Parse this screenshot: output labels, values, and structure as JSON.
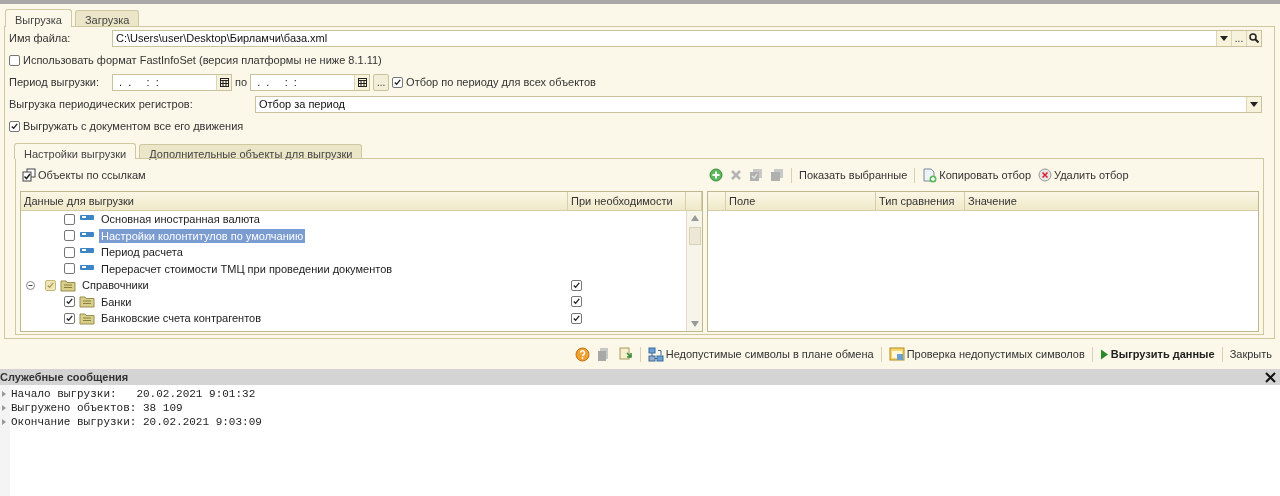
{
  "tabs": [
    {
      "label": "Выгрузка",
      "selected": true
    },
    {
      "label": "Загрузка",
      "selected": false
    }
  ],
  "form": {
    "file": {
      "label": "Имя файла:",
      "value": "C:\\Users\\user\\Desktop\\Бирламчи\\база.xml",
      "button": "..."
    },
    "fastinfoset": {
      "label": "Использовать формат FastInfoSet (версия платформы не ниже 8.1.11)",
      "checked": false
    },
    "period": {
      "label": "Период выгрузки:",
      "from": " .  .     :  :",
      "separator": "по",
      "to": " .  .     :  :",
      "button": "...",
      "filter": {
        "label": "Отбор по периоду для всех объектов",
        "checked": true
      }
    },
    "registers": {
      "label": "Выгрузка периодических регистров:",
      "value": "Отбор за период"
    },
    "movements": {
      "label": "Выгружать с документом все его движения",
      "checked": true
    }
  },
  "sub_tabs": [
    {
      "label": "Настройки выгрузки",
      "selected": true
    },
    {
      "label": "Дополнительные объекты для выгрузки",
      "selected": false
    }
  ],
  "objects_toggle": {
    "label": "Объекты по ссылкам"
  },
  "tree": {
    "columns": [
      "Данные для выгрузки",
      "При необходимости"
    ],
    "items": [
      {
        "children": [
          {
            "kind": "constant",
            "label": "Основная иностранная валюта",
            "checked": false,
            "selected": false
          },
          {
            "kind": "constant",
            "label": "Настройки колонтитулов по умолчанию",
            "checked": false,
            "selected": true
          },
          {
            "kind": "constant",
            "label": "Период расчета",
            "checked": false,
            "selected": false
          },
          {
            "kind": "constant",
            "label": "Перерасчет стоимости ТМЦ при проведении документов",
            "checked": false,
            "selected": false
          }
        ]
      },
      {
        "kind": "group",
        "label": "Справочники",
        "checked": true,
        "partial": true,
        "expanded": true,
        "on_demand": true,
        "selected": false,
        "children": [
          {
            "kind": "catalog",
            "label": "Банки",
            "checked": true,
            "on_demand": true,
            "selected": false
          },
          {
            "kind": "catalog",
            "label": "Банковские счета контрагентов",
            "checked": true,
            "on_demand": true,
            "selected": false
          }
        ]
      }
    ]
  },
  "filter_toolbar": {
    "show_selected": "Показать выбранные",
    "copy": "Копировать отбор",
    "remove": "Удалить отбор"
  },
  "filter_table": {
    "columns": [
      "Поле",
      "Тип сравнения",
      "Значение"
    ]
  },
  "bottom_toolbar": {
    "invalid_chars": "Недопустимые символы в плане обмена",
    "check_chars": "Проверка недопустимых символов",
    "export": "Выгрузить данные",
    "close": "Закрыть"
  },
  "messages": {
    "title": "Служебные сообщения",
    "lines": [
      "Начало выгрузки:   20.02.2021 9:01:32",
      "Выгружено объектов: 38 109",
      "Окончание выгрузки: 20.02.2021 9:03:09"
    ]
  }
}
